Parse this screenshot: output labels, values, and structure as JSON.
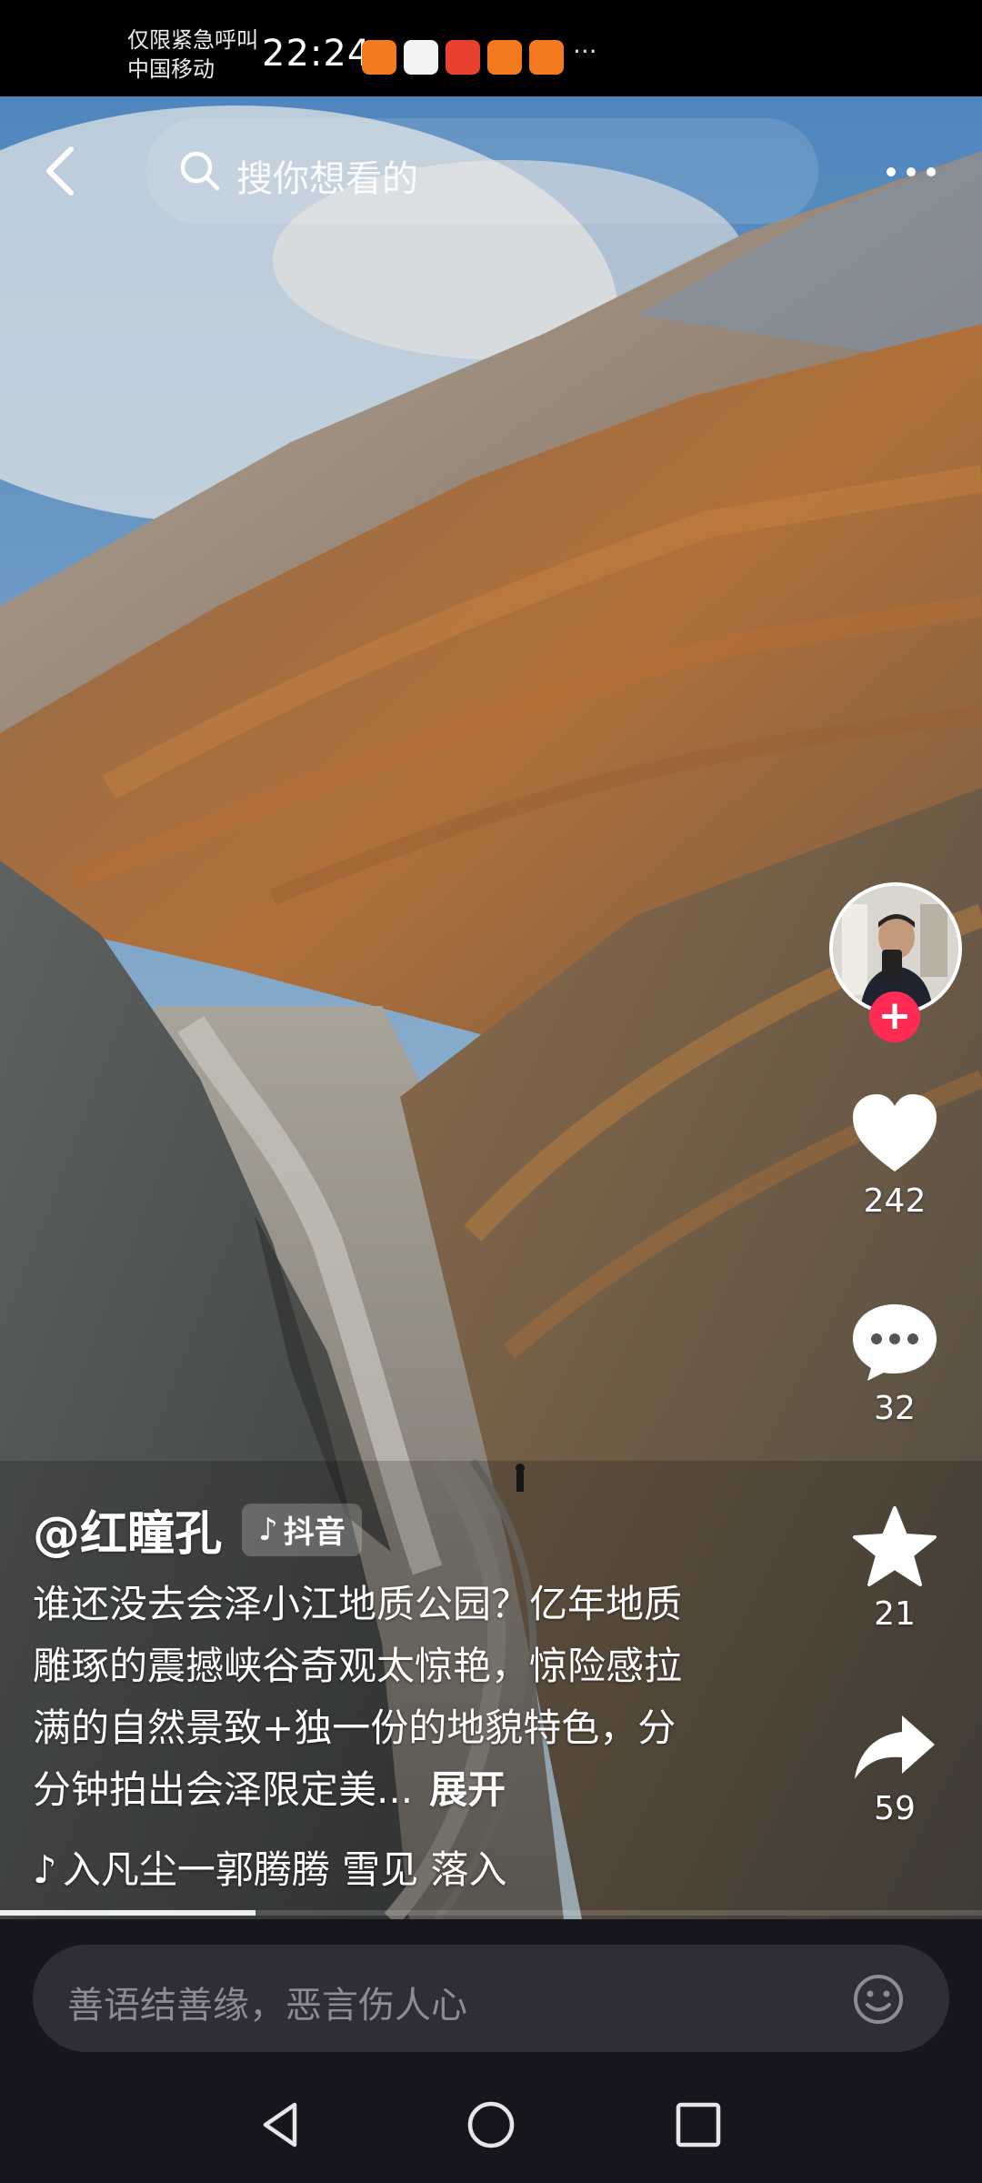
{
  "status_bar": {
    "carrier_line1": "仅限紧急呼叫",
    "carrier_line2": "中国移动",
    "time": "22:24",
    "more": "···"
  },
  "top_bar": {
    "search_placeholder": "搜你想看的"
  },
  "author": {
    "handle": "@红瞳孔",
    "source_badge": "抖音"
  },
  "caption": {
    "text": "谁还没去会泽小江地质公园？亿年地质雕琢的震撼峡谷奇观太惊艳，惊险感拉满的自然景致+独一份的地貌特色，分分钟拍出会泽限定美...",
    "expand_label": "展开"
  },
  "music": {
    "text": "入凡尘一郭腾腾   雪见   落入"
  },
  "actions": {
    "likes": "242",
    "comments": "32",
    "favorites": "21",
    "shares": "59"
  },
  "progress": 0.26,
  "comment_bar": {
    "placeholder": "善语结善缘，恶言伤人心"
  },
  "colors": {
    "follow_accent": "#fe2c55",
    "bottom_bg": "#16161e"
  }
}
